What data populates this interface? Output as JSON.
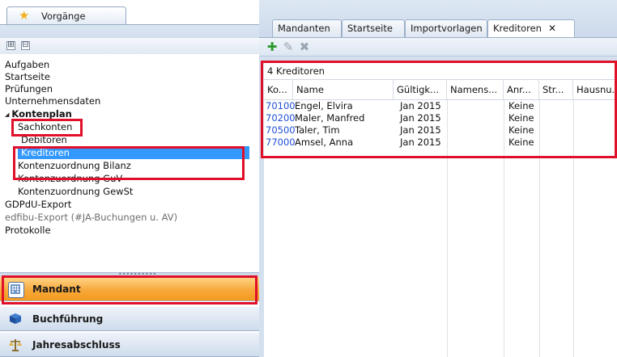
{
  "left_panel": {
    "tab_label": "Vorgänge",
    "expand_all": "⊞",
    "collapse_all": "⊟",
    "tree": [
      {
        "label": "Aufgaben"
      },
      {
        "label": "Startseite"
      },
      {
        "label": "Prüfungen"
      },
      {
        "label": "Unternehmensdaten"
      },
      {
        "label": "Kontenplan",
        "expanded": true
      },
      {
        "label": "Sachkonten"
      },
      {
        "label": "Debitoren"
      },
      {
        "label": "Kreditoren",
        "selected": true
      },
      {
        "label": "Kontenzuordnung Bilanz"
      },
      {
        "label": "Kontenzuordnung GuV"
      },
      {
        "label": "Kontenzuordnung GewSt"
      },
      {
        "label": "GDPdU-Export"
      },
      {
        "label": "edfibu-Export (#JA-Buchungen u. AV)",
        "disabled": true
      },
      {
        "label": "Protokolle"
      }
    ],
    "nav": [
      {
        "label": "Mandant",
        "active": true,
        "icon": "building-icon"
      },
      {
        "label": "Buchführung",
        "icon": "book-icon"
      },
      {
        "label": "Jahresabschluss",
        "icon": "scales-icon"
      }
    ]
  },
  "tabs": [
    {
      "label": "Mandanten"
    },
    {
      "label": "Startseite"
    },
    {
      "label": "Importvorlagen"
    },
    {
      "label": "Kreditoren",
      "active": true,
      "close": "✕"
    }
  ],
  "toolbar": {
    "add_icon": "plus-icon",
    "edit_icon": "pencil-icon",
    "delete_icon": "delete-icon"
  },
  "grid": {
    "title": "4 Kreditoren",
    "columns": [
      "Ko...",
      "Name",
      "Gültigk...",
      "Namens...",
      "Anr...",
      "Str...",
      "Hausnu..."
    ],
    "rows": [
      [
        "70100",
        "Engel, Elvira",
        "Jan 2015",
        "",
        "Keine",
        "",
        ""
      ],
      [
        "70200",
        "Maler, Manfred",
        "Jan 2015",
        "",
        "Keine",
        "",
        ""
      ],
      [
        "70500",
        "Taler, Tim",
        "Jan 2015",
        "",
        "Keine",
        "",
        ""
      ],
      [
        "77000",
        "Amsel, Anna",
        "Jan 2015",
        "",
        "Keine",
        "",
        ""
      ]
    ]
  },
  "colors": {
    "accent_orange": "#f7a93c",
    "selection_blue": "#3399ff",
    "highlight_red": "#e0102a",
    "link_blue": "#1f4fd6"
  }
}
